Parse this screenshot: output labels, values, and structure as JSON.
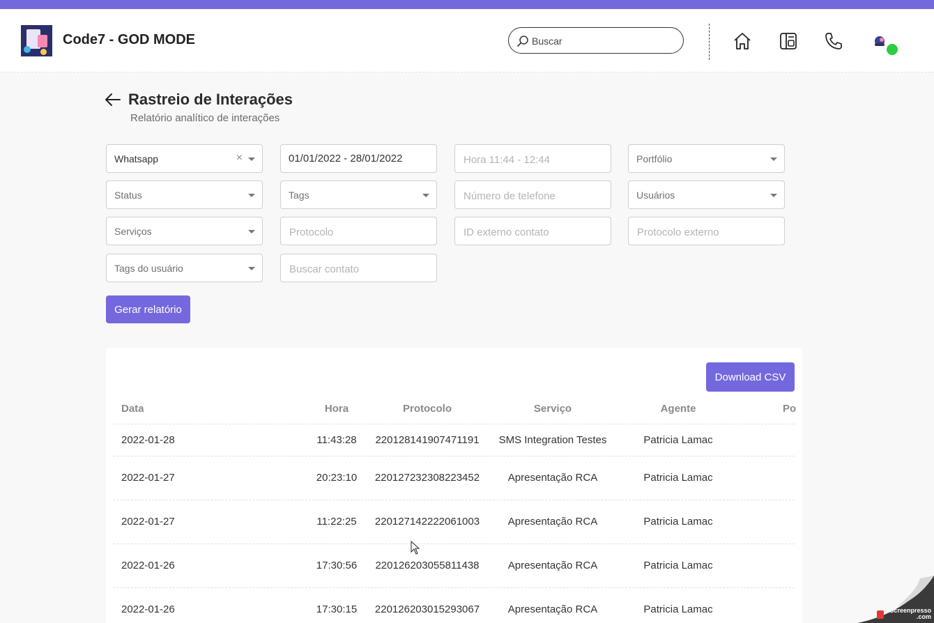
{
  "colors": {
    "accent": "#7468de",
    "status_online": "#2ecc40"
  },
  "header": {
    "app_title": "Code7 - GOD MODE",
    "search_placeholder": "Buscar",
    "icons": [
      "home-icon",
      "layout-icon",
      "phone-icon",
      "avatar"
    ]
  },
  "page": {
    "title": "Rastreio de Interações",
    "subtitle": "Relatório analítico de interações"
  },
  "filters": {
    "channel": "Whatsapp",
    "date_range": "01/01/2022 - 28/01/2022",
    "time_placeholder": "Hora 11:44 - 12:44",
    "portfolio": "Portfólio",
    "status": "Status",
    "tags": "Tags",
    "phone_placeholder": "Número de telefone",
    "users": "Usuários",
    "services": "Serviços",
    "protocol_placeholder": "Protocolo",
    "external_contact_id_placeholder": "ID externo contato",
    "external_protocol_placeholder": "Protocolo externo",
    "user_tags": "Tags do usuário",
    "search_contact_placeholder": "Buscar contato"
  },
  "actions": {
    "generate_report": "Gerar relatório",
    "download_csv": "Download CSV"
  },
  "table": {
    "headers": {
      "data": "Data",
      "hora": "Hora",
      "protocolo": "Protocolo",
      "servico": "Serviço",
      "agente": "Agente",
      "portfolio": "Po"
    },
    "rows": [
      {
        "data": "2022-01-28",
        "hora": "11:43:28",
        "protocolo": "220128141907471191",
        "servico": "SMS Integration Testes",
        "agente": "Patricia Lamac"
      },
      {
        "data": "2022-01-27",
        "hora": "20:23:10",
        "protocolo": "220127232308223452",
        "servico": "Apresentação RCA",
        "agente": "Patricia Lamac"
      },
      {
        "data": "2022-01-27",
        "hora": "11:22:25",
        "protocolo": "220127142222061003",
        "servico": "Apresentação RCA",
        "agente": "Patricia Lamac"
      },
      {
        "data": "2022-01-26",
        "hora": "17:30:56",
        "protocolo": "220126203055811438",
        "servico": "Apresentação RCA",
        "agente": "Patricia Lamac"
      },
      {
        "data": "2022-01-26",
        "hora": "17:30:15",
        "protocolo": "220126203015293067",
        "servico": "Apresentação RCA",
        "agente": "Patricia Lamac"
      }
    ]
  },
  "watermark": {
    "line1": "Screenpresso",
    "line2": ".com"
  }
}
